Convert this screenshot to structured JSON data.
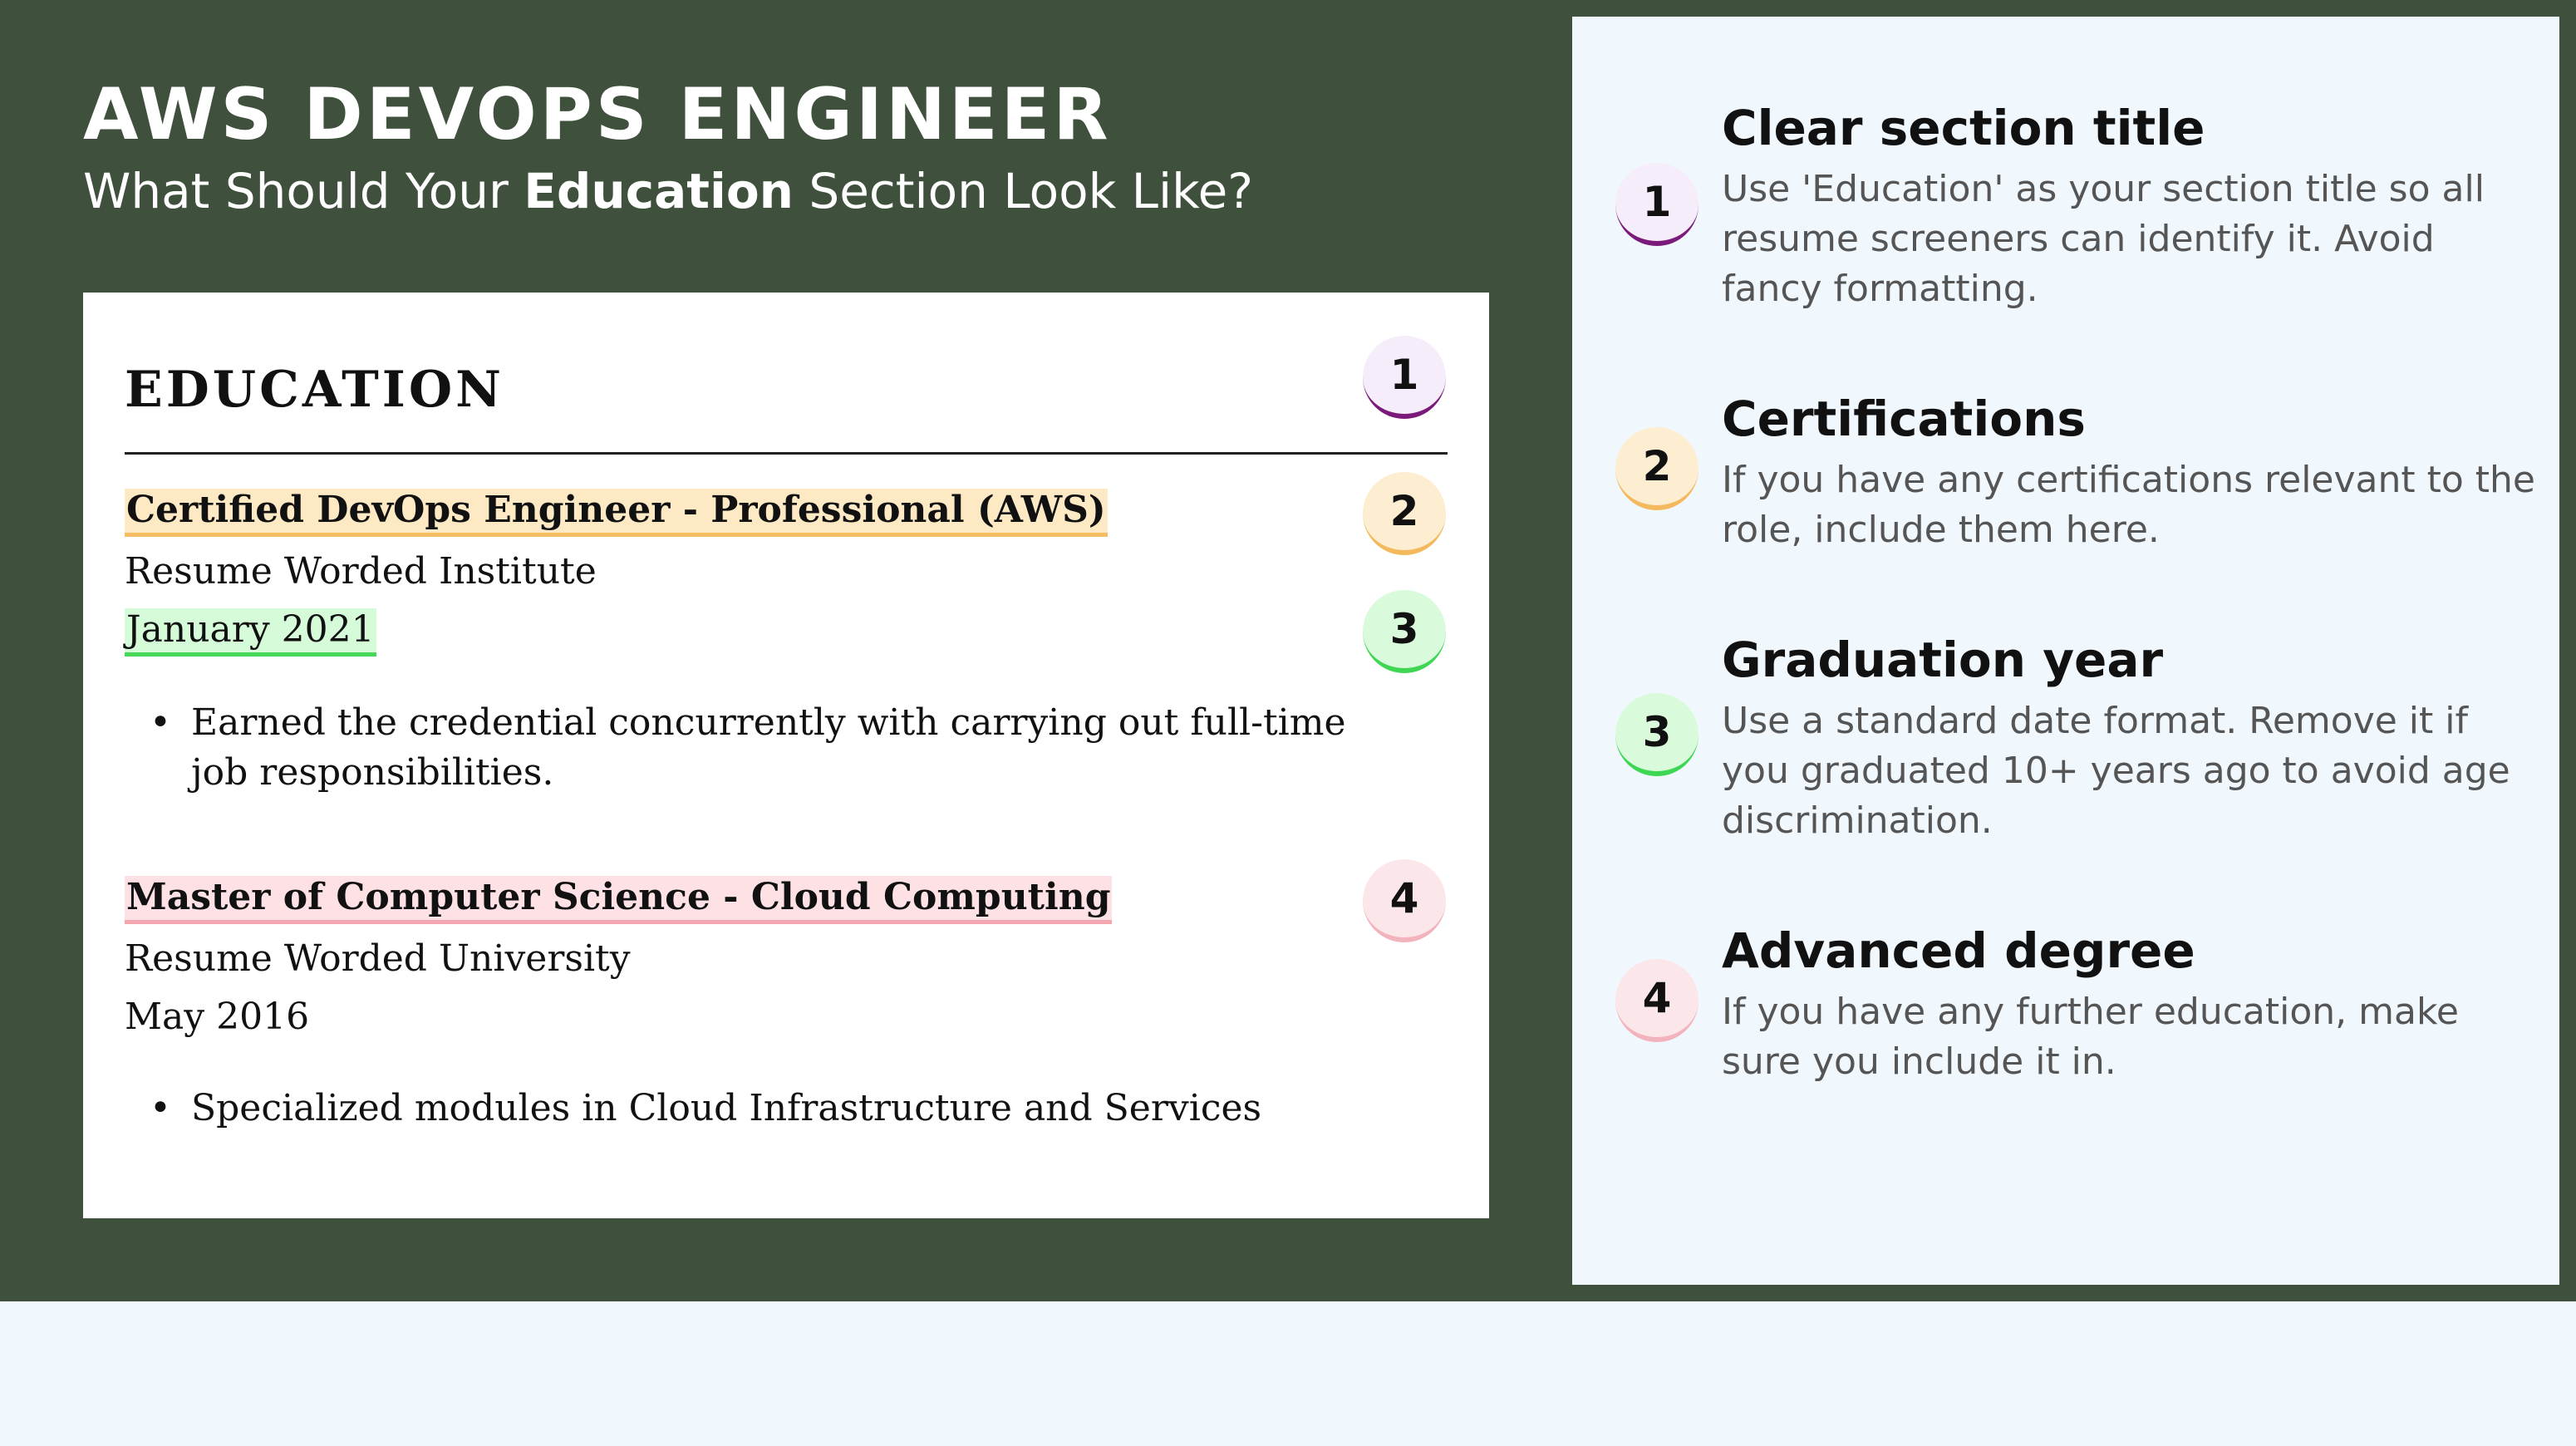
{
  "header": {
    "title": "AWS DEVOPS ENGINEER",
    "subtitle_pre": "What Should Your ",
    "subtitle_bold": "Education",
    "subtitle_post": " Section Look Like?"
  },
  "resume": {
    "section_heading": "EDUCATION",
    "entries": [
      {
        "title": "Certified DevOps Engineer - Professional (AWS)",
        "institution": "Resume Worded Institute",
        "date": "January 2021",
        "bullet": "Earned the credential concurrently with carrying out full-time job responsibilities."
      },
      {
        "title": "Master of Computer Science - Cloud Computing",
        "institution": "Resume Worded University",
        "date": "May 2016",
        "bullet": "Specialized modules in Cloud Infrastructure and Services"
      }
    ],
    "bullet_glyph": "•"
  },
  "badges": [
    "1",
    "2",
    "3",
    "4"
  ],
  "tips": [
    {
      "heading": "Clear section title",
      "text": "Use 'Education' as your section title so all resume screeners can identify it. Avoid fancy formatting."
    },
    {
      "heading": "Certifications",
      "text": "If you have any certifications relevant to the role, include them here."
    },
    {
      "heading": "Graduation year",
      "text": "Use a standard date format. Remove it if you graduated 10+ years ago to avoid age discrimination."
    },
    {
      "heading": "Advanced degree",
      "text": "If you have any further education, make sure you include it in."
    }
  ],
  "colors": {
    "background_green": "#3f513c",
    "page_background": "#f0f7fd",
    "badge_1": "#7b1a7a",
    "badge_2": "#f3b95c",
    "badge_3": "#3ed653",
    "badge_4": "#f3b3bc"
  }
}
